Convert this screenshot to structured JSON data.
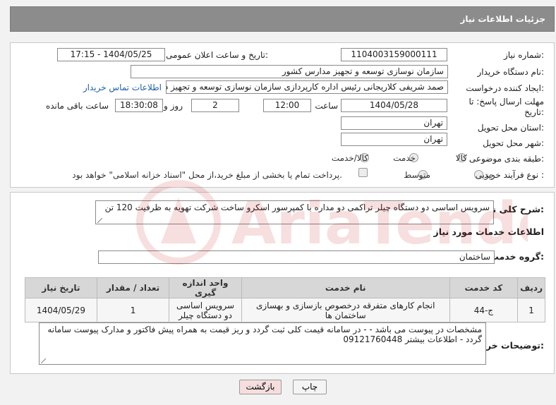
{
  "header": {
    "title": "جزئیات اطلاعات نیاز"
  },
  "form": {
    "need_number_label": "شماره نیاز:",
    "need_number": "1104003159000111",
    "announce_label": "تاریخ و ساعت اعلان عمومی:",
    "announce_value": "1404/05/25 - 17:15",
    "buyer_org_label": "نام دستگاه خریدار:",
    "buyer_org": "سازمان نوسازی  توسعه و تجهیز مدارس کشور",
    "creator_label": "ایجاد کننده درخواست:",
    "creator": "صمد شریفی کلاریجانی رئیس اداره کارپردازی سازمان نوسازی  توسعه و تجهیز د",
    "contact_link": "اطلاعات تماس خریدار",
    "deadline_label_1": "مهلت ارسال پاسخ: تا",
    "deadline_label_2": "تاریخ:",
    "deadline_date": "1404/05/28",
    "time_label": "ساعت",
    "deadline_time": "12:00",
    "days_value": "2",
    "days_label": "روز و",
    "remaining_time": "18:30:08",
    "remaining_label": "ساعت باقی مانده",
    "province_label": "استان محل تحویل:",
    "province": "تهران",
    "city_label": "شهر محل تحویل:",
    "city": "تهران",
    "category_label": "طبقه بندی موضوعی:",
    "category_options": [
      "کالا",
      "خدمت",
      "کالا/خدمت"
    ],
    "process_label": "نوع فرآیند خرید :",
    "process_options": [
      "جزیی",
      "متوسط"
    ],
    "payment_note": "پرداخت تمام یا بخشی از مبلغ خرید،از محل \"اسناد خزانه اسلامی\" خواهد بود."
  },
  "description": {
    "label": "شرح کلی نیاز:",
    "text": "سرویس اساسی دو دستگاه چیلر تراکمی دو مداره با کمپرسور اسکرو ساخت شرکت تهویه به ظرفیت 120 تن"
  },
  "services": {
    "section_title": "اطلاعات خدمات مورد نیاز",
    "group_label": "گروه خدمت:",
    "group_value": "ساختمان",
    "columns": [
      "ردیف",
      "کد خدمت",
      "نام خدمت",
      "واحد اندازه گیری",
      "تعداد / مقدار",
      "تاریخ نیاز"
    ],
    "rows": [
      [
        "1",
        "ج-44",
        "انجام کارهای متفرقه درخصوص بازسازی و بهسازی ساختمان ها",
        "سرویس اساسی دو دستگاه چیلر",
        "1",
        "1404/05/29"
      ]
    ]
  },
  "buyer_notes": {
    "label": "توضیحات خریدار:",
    "text": "مشخصات در پیوست می باشد - -   در سامانه قیمت کلی ثبت گردد و ریز قیمت به همراه پیش فاکتور و مدارک پیوست سامانه گردد - اطلاعات بیشتر 09121760448"
  },
  "buttons": {
    "print": "چاپ",
    "back": "بازگشت"
  },
  "watermark": {
    "text": "AriaTender.neT"
  },
  "colors": {
    "header_bg": "#8c8c8c",
    "link": "#1f5fb0",
    "back_button": "#f6dede"
  }
}
